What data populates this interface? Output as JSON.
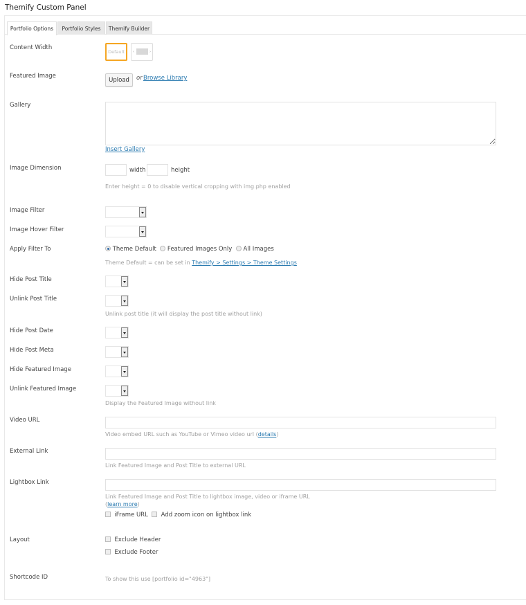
{
  "panel": {
    "title": "Themify Custom Panel"
  },
  "tabs": [
    {
      "label": "Portfolio Options",
      "active": true
    },
    {
      "label": "Portfolio Styles",
      "active": false
    },
    {
      "label": "Themify Builder",
      "active": false
    }
  ],
  "accent_color": "#f5a623",
  "link_color": "#2a7ab0",
  "fields": {
    "content_width": {
      "label": "Content Width",
      "options": [
        "Default",
        "Fullwidth"
      ],
      "selected": "Default",
      "default_text": "Default"
    },
    "featured_image": {
      "label": "Featured Image",
      "upload_label": "Upload",
      "or_text": "or",
      "browse_label": "Browse Library"
    },
    "gallery": {
      "label": "Gallery",
      "value": "",
      "insert_label": "Insert Gallery"
    },
    "image_dimension": {
      "label": "Image Dimension",
      "width_value": "",
      "width_label": "width",
      "height_value": "",
      "height_label": "height",
      "hint": "Enter height = 0 to disable vertical cropping with img.php enabled"
    },
    "image_filter": {
      "label": "Image Filter",
      "value": ""
    },
    "image_hover_filter": {
      "label": "Image Hover Filter",
      "value": ""
    },
    "apply_filter_to": {
      "label": "Apply Filter To",
      "options": [
        "Theme Default",
        "Featured Images Only",
        "All Images"
      ],
      "selected": "Theme Default",
      "hint_prefix": "Theme Default = can be set in ",
      "hint_link": "Themify > Settings > Theme Settings"
    },
    "hide_post_title": {
      "label": "Hide Post Title",
      "value": ""
    },
    "unlink_post_title": {
      "label": "Unlink Post Title",
      "value": "",
      "hint": "Unlink post title (it will display the post title without link)"
    },
    "hide_post_date": {
      "label": "Hide Post Date",
      "value": ""
    },
    "hide_post_meta": {
      "label": "Hide Post Meta",
      "value": ""
    },
    "hide_featured_image": {
      "label": "Hide Featured Image",
      "value": ""
    },
    "unlink_featured_image": {
      "label": "Unlink Featured Image",
      "value": "",
      "hint": "Display the Featured Image without link"
    },
    "video_url": {
      "label": "Video URL",
      "value": "",
      "hint_prefix": "Video embed URL such as YouTube or Vimeo video url (",
      "hint_link": "details",
      "hint_suffix": ")"
    },
    "external_link": {
      "label": "External Link",
      "value": "",
      "hint": "Link Featured Image and Post Title to external URL"
    },
    "lightbox_link": {
      "label": "Lightbox Link",
      "value": "",
      "hint": "Link Featured Image and Post Title to lightbox image, video or iframe URL",
      "learn_prefix": "(",
      "learn_link": "learn more",
      "learn_suffix": ")",
      "iframe_label": "iFrame URL",
      "iframe_checked": false,
      "zoom_label": "Add zoom icon on lightbox link",
      "zoom_checked": false
    },
    "layout": {
      "label": "Layout",
      "exclude_header_label": "Exclude Header",
      "exclude_header_checked": false,
      "exclude_footer_label": "Exclude Footer",
      "exclude_footer_checked": false
    },
    "shortcode_id": {
      "label": "Shortcode ID",
      "text": "To show this use [portfolio id=\"4963\"]"
    }
  }
}
